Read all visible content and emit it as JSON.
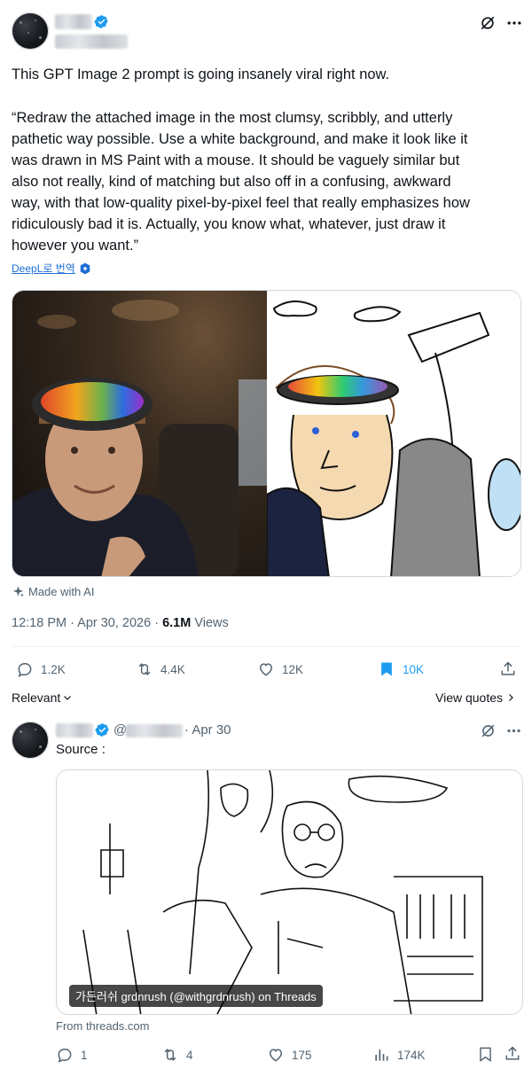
{
  "post": {
    "text_intro": "This GPT Image 2 prompt is going insanely viral right now.",
    "quote_lines": [
      "“Redraw the attached image in the most clumsy, scribbly, and utterly",
      "pathetic way possible. Use a white background, and make it look like it",
      "was drawn in MS Paint with a mouse. It should be vaguely similar but",
      "also not really, kind of matching but also off in a confusing, awkward",
      "way, with that low-quality pixel-by-pixel feel that really emphasizes how",
      "ridiculously bad it is. Actually, you know what, whatever, just draw it",
      "however you want.”"
    ],
    "translate_link": "DeepL로 번역",
    "made_with_ai": "Made with AI",
    "time": "12:18 PM · Apr 30, 2026 · ",
    "views_count": "6.1M",
    "views_label": " Views",
    "actions": {
      "reply": "1.2K",
      "repost": "4.4K",
      "like": "12K",
      "bookmark": "10K"
    }
  },
  "replies_bar": {
    "sort_label": "Relevant",
    "view_quotes": "View quotes"
  },
  "reply": {
    "handle_prefix": "@",
    "date": "· Apr 30",
    "text": "Source :",
    "media_caption": "가든러쉬 grdnrush (@withgrdnrush) on Threads",
    "source_domain": "From threads.com",
    "actions": {
      "reply": "1",
      "repost": "4",
      "like": "175",
      "views": "174K"
    }
  },
  "colors": {
    "accent": "#1d9bf0",
    "bookmark_active": "#1d9bf0",
    "muted": "#536471"
  }
}
